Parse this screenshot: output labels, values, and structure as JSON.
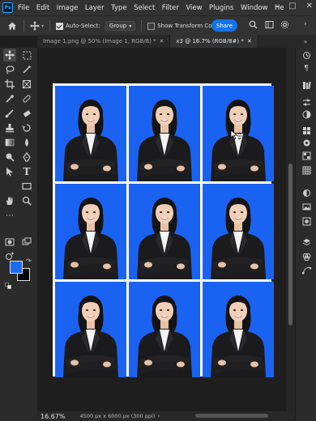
{
  "app": {
    "logo": "Ps",
    "menu": [
      "File",
      "Edit",
      "Image",
      "Layer",
      "Type",
      "Select",
      "Filter",
      "View",
      "Plugins",
      "Window",
      "He"
    ],
    "window_controls": [
      "–",
      "□",
      "✕"
    ]
  },
  "options": {
    "auto_select_label": "Auto-Select:",
    "auto_select_checked": true,
    "group_value": "Group",
    "transform_label": "Show Transform Contro",
    "transform_checked": false,
    "share_label": "Share"
  },
  "tabs": [
    {
      "label": "Image 1.png @ 50% (Image 1, RGB/8) *",
      "active": false
    },
    {
      "label": "x3 @ 16.7% (RGB/8#) *",
      "active": true
    }
  ],
  "colors": {
    "foreground": "#1a6bf0",
    "background": "#000000",
    "photo_bg": "#1a63f2"
  },
  "grid": {
    "rows": 3,
    "cols": 3
  },
  "status": {
    "zoom": "16.67%",
    "doc_info": "4500 px x 6000 px (300 ppi)"
  },
  "icons": {
    "left_tools": [
      "move-icon",
      "marquee-icon",
      "lasso-icon",
      "object-select-icon",
      "crop-icon",
      "frame-icon",
      "eyedropper-icon",
      "healing-icon",
      "brush-icon",
      "eraser-icon",
      "stamp-icon",
      "history-brush-icon",
      "gradient-icon",
      "blur-icon",
      "dodge-icon",
      "pen-icon",
      "type-icon",
      "path-select-icon",
      "shape-icon",
      "hand-icon",
      "zoom-icon",
      "more-tools-icon"
    ],
    "right_panel": [
      "history-icon",
      "paragraph-icon",
      "libraries-icon",
      "properties-icon",
      "adjustments-icon",
      "swatches-icon",
      "gradients-icon",
      "patterns-icon",
      "layers-icon",
      "channels-icon",
      "paths-icon"
    ]
  }
}
